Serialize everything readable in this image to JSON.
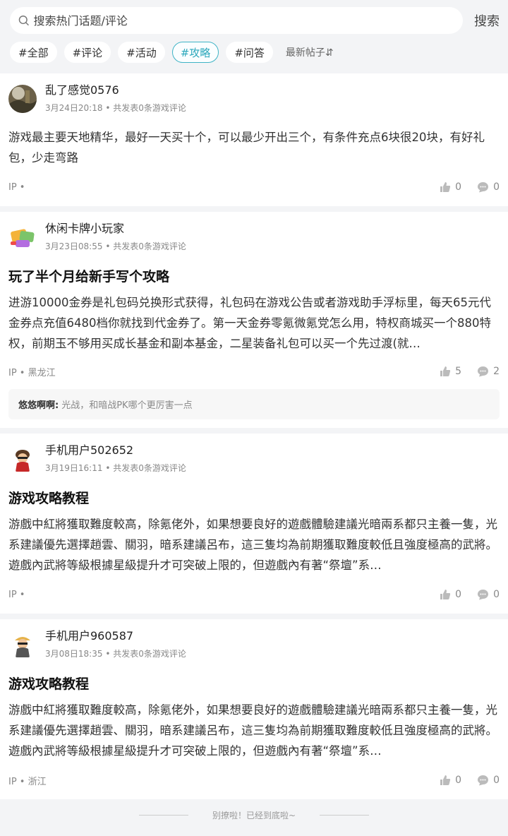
{
  "search": {
    "placeholder": "搜索热门话题/评论",
    "button": "搜索"
  },
  "tags": [
    "#全部",
    "#评论",
    "#活动",
    "#攻略",
    "#问答"
  ],
  "active_tag": "#攻略",
  "sort_label": "最新帖子⇵",
  "accent_color": "#2ba7bb",
  "posts": [
    {
      "user": "乱了感觉0576",
      "time": "3月24日20:18",
      "stat": "• 共发表0条游戏评论",
      "title": "",
      "body": "游戏最主要天地精华，最好一天买十个，可以最少开出三个，有条件充点6块很20块，有好礼包，少走弯路",
      "ip": "IP •",
      "likes": "0",
      "comments": "0"
    },
    {
      "user": "休闲卡牌小玩家",
      "time": "3月23日08:55",
      "stat": "• 共发表0条游戏评论",
      "title": "玩了半个月给新手写个攻略",
      "body": "进游10000金券是礼包码兑换形式获得，礼包码在游戏公告或者游戏助手浮标里，每天65元代金券点充值6480档你就找到代金券了。第一天金券零氪微氪党怎么用，特权商城买一个880特权，前期玉不够用买成长基金和副本基金，二星装备礼包可以买一个先过渡(就…",
      "ip": "IP • 黑龙江",
      "likes": "5",
      "comments": "2",
      "reply_user": "悠悠啊啊:",
      "reply_text": "光战，和暗战PK哪个更厉害一点"
    },
    {
      "user": "手机用户502652",
      "time": "3月19日16:11",
      "stat": "• 共发表0条游戏评论",
      "title": "游戏攻略教程",
      "body": "游戲中紅將獲取難度較高，除氪佬外，如果想要良好的遊戲體驗建議光暗兩系都只主養一隻，光系建議優先選擇趙雲、關羽，暗系建議呂布，這三隻均為前期獲取難度較低且強度極高的武將。遊戲內武將等級根據星級提升才可突破上限的，但遊戲內有著“祭壇”系…",
      "ip": "IP •",
      "likes": "0",
      "comments": "0"
    },
    {
      "user": "手机用户960587",
      "time": "3月08日18:35",
      "stat": "• 共发表0条游戏评论",
      "title": "游戏攻略教程",
      "body": "游戲中紅將獲取難度較高，除氪佬外，如果想要良好的遊戲體驗建議光暗兩系都只主養一隻，光系建議優先選擇趙雲、關羽，暗系建議呂布，這三隻均為前期獲取難度較低且強度極高的武將。遊戲內武將等級根據星級提升才可突破上限的，但遊戲內有著“祭壇”系…",
      "ip": "IP • 浙江",
      "likes": "0",
      "comments": "0"
    }
  ],
  "end_text": "别撩啦！已经到底啦~"
}
